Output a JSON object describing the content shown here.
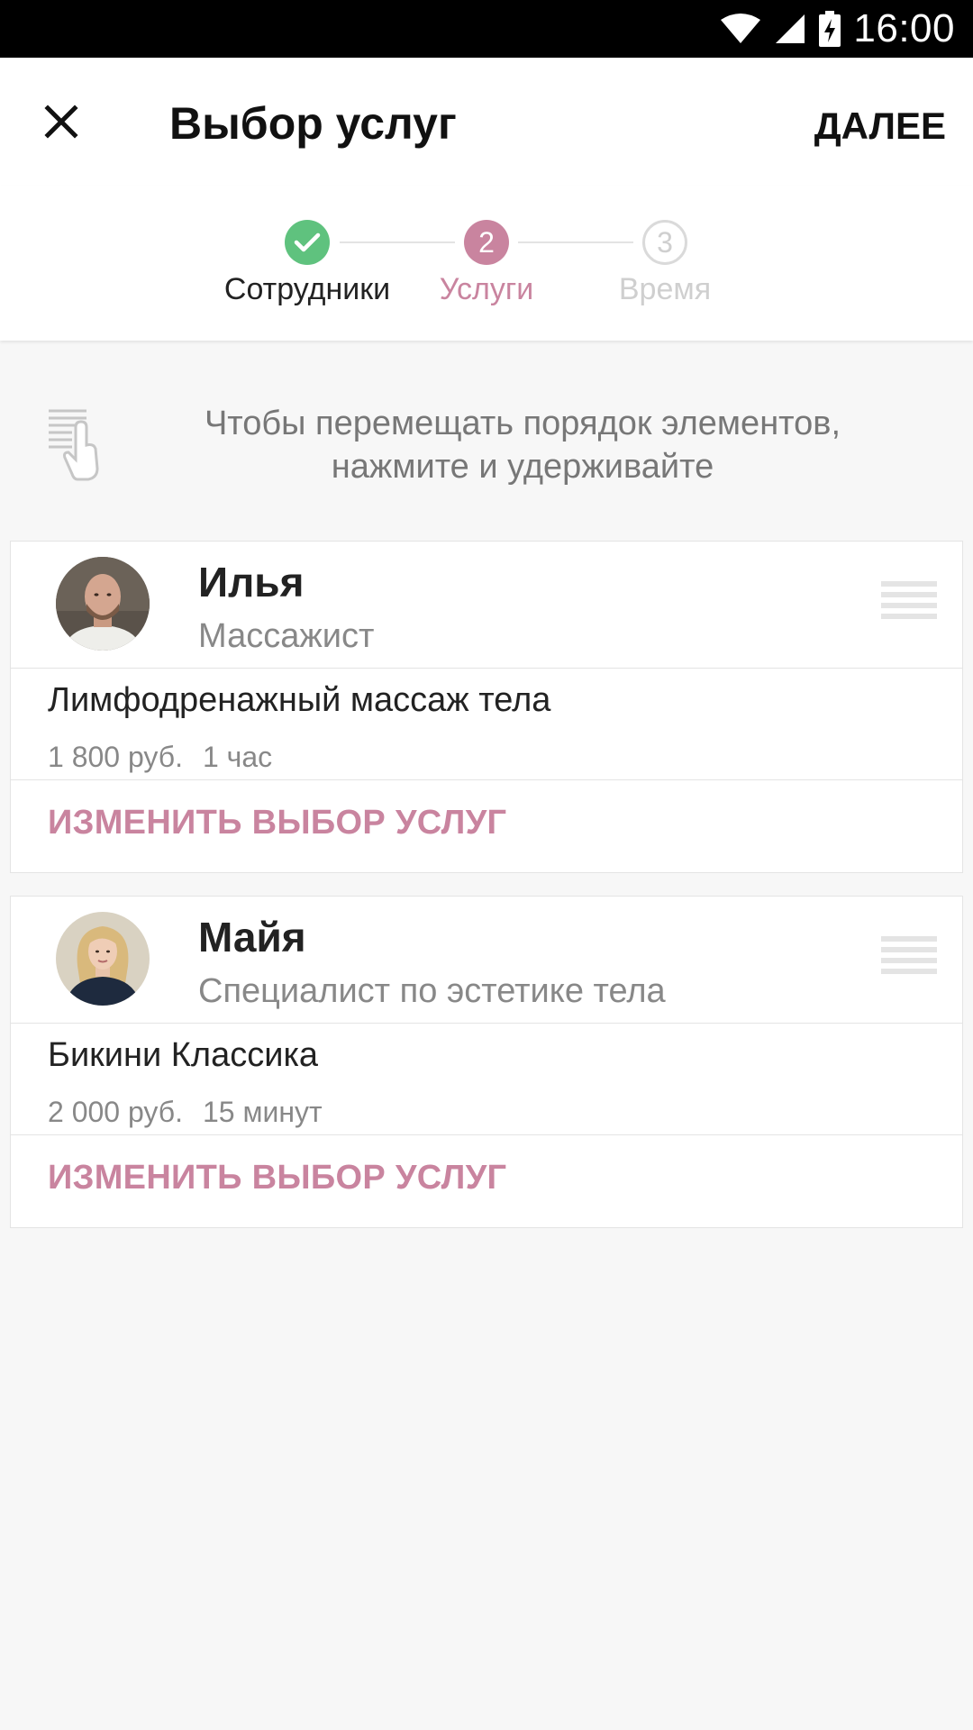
{
  "status_bar": {
    "time": "16:00"
  },
  "header": {
    "title": "Выбор услуг",
    "next_label": "ДАЛЕЕ"
  },
  "stepper": {
    "steps": [
      {
        "number": "1",
        "label": "Сотрудники",
        "state": "done"
      },
      {
        "number": "2",
        "label": "Услуги",
        "state": "active"
      },
      {
        "number": "3",
        "label": "Время",
        "state": "upcoming"
      }
    ]
  },
  "hint": {
    "line1": "Чтобы перемещать порядок элементов,",
    "line2": "нажмите и удерживайте"
  },
  "cards": [
    {
      "name": "Илья",
      "role": "Массажист",
      "service": {
        "title": "Лимфодренажный массаж тела",
        "price": "1 800 руб.",
        "duration": "1 час"
      },
      "change_label": "ИЗМЕНИТЬ ВЫБОР УСЛУГ"
    },
    {
      "name": "Майя",
      "role": "Специалист по эстетике тела",
      "service": {
        "title": "Бикини Классика",
        "price": "2 000 руб.",
        "duration": "15 минут"
      },
      "change_label": "ИЗМЕНИТЬ ВЫБОР УСЛУГ"
    }
  ],
  "colors": {
    "accent": "#c9849f",
    "done": "#5fc27e",
    "divider": "#e4e4e4",
    "muted_text": "#888888"
  }
}
